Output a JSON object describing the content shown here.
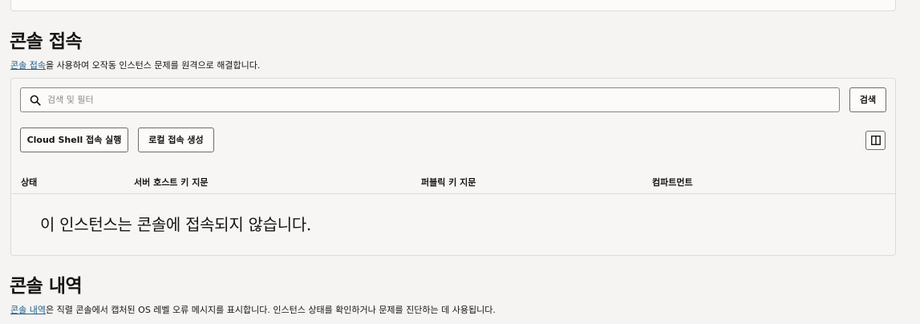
{
  "console_access": {
    "title": "콘솔 접속",
    "desc_link": "콘솔 접속",
    "desc_rest": "을 사용하여 오작동 인스턴스 문제를 원격으로 해결합니다.",
    "search": {
      "placeholder": "검색 및 필터",
      "button_label": "검색"
    },
    "actions": {
      "cloud_shell": "Cloud Shell 접속 실행",
      "local": "로컬 접속 생성"
    },
    "table": {
      "columns": [
        "상태",
        "서버 호스트 키 지문",
        "퍼블릭 키 지문",
        "컴파트먼트"
      ],
      "empty_message": "이 인스턴스는 콘솔에 접속되지 않습니다."
    }
  },
  "console_history": {
    "title": "콘솔 내역",
    "desc_link": "콘솔 내역",
    "desc_rest": "은 직렬 콘솔에서 캡처된 OS 레벨 오류 메시지를 표시합니다. 인스턴스 상태를 확인하거나 문제를 진단하는 데 사용됩니다."
  },
  "icons": {
    "search": "search-icon",
    "columns": "columns-icon"
  }
}
